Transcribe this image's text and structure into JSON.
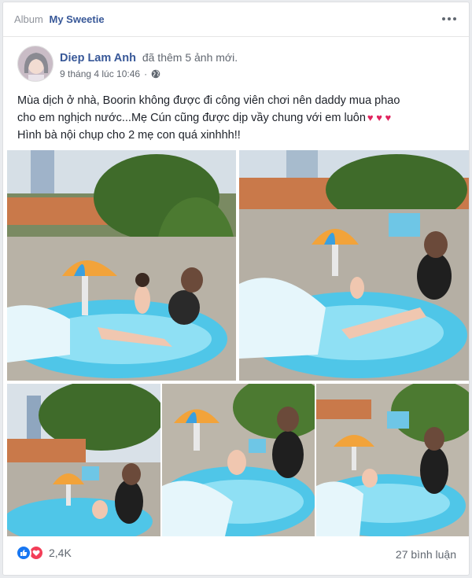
{
  "album": {
    "label": "Album",
    "name": "My Sweetie"
  },
  "post": {
    "author": "Diep Lam Anh",
    "action": "đã thêm 5 ảnh mới.",
    "timestamp": "9 tháng 4 lúc 10:46",
    "privacy_icon": "globe-icon",
    "text_line1": "Mùa dịch ở nhà, Boorin không được đi công viên chơi nên daddy mua phao",
    "text_line2": "cho em nghịch nước...Mẹ Cún cũng được dịp vầy chung với em luôn",
    "hearts": "♥ ♥ ♥",
    "text_line3": "Hình bà nội chụp cho 2 mẹ con quá xinhhh!!"
  },
  "photos": [
    {
      "name": "photo-1",
      "desc": "mother and toddler in inflatable pool under umbrella"
    },
    {
      "name": "photo-2",
      "desc": "mother holding water bucket over pool"
    },
    {
      "name": "photo-3",
      "desc": "mother on balcony with potted plants"
    },
    {
      "name": "photo-4",
      "desc": "mother pouring water for child"
    },
    {
      "name": "photo-5",
      "desc": "mother splashing water in pool"
    }
  ],
  "footer": {
    "reaction_icons": [
      "like-icon",
      "love-icon"
    ],
    "reaction_count": "2,4K",
    "comment_count": "27 bình luận"
  },
  "colors": {
    "link": "#385898",
    "like": "#1877f2",
    "love": "#f33e58",
    "pool": "#4fc6e8"
  }
}
